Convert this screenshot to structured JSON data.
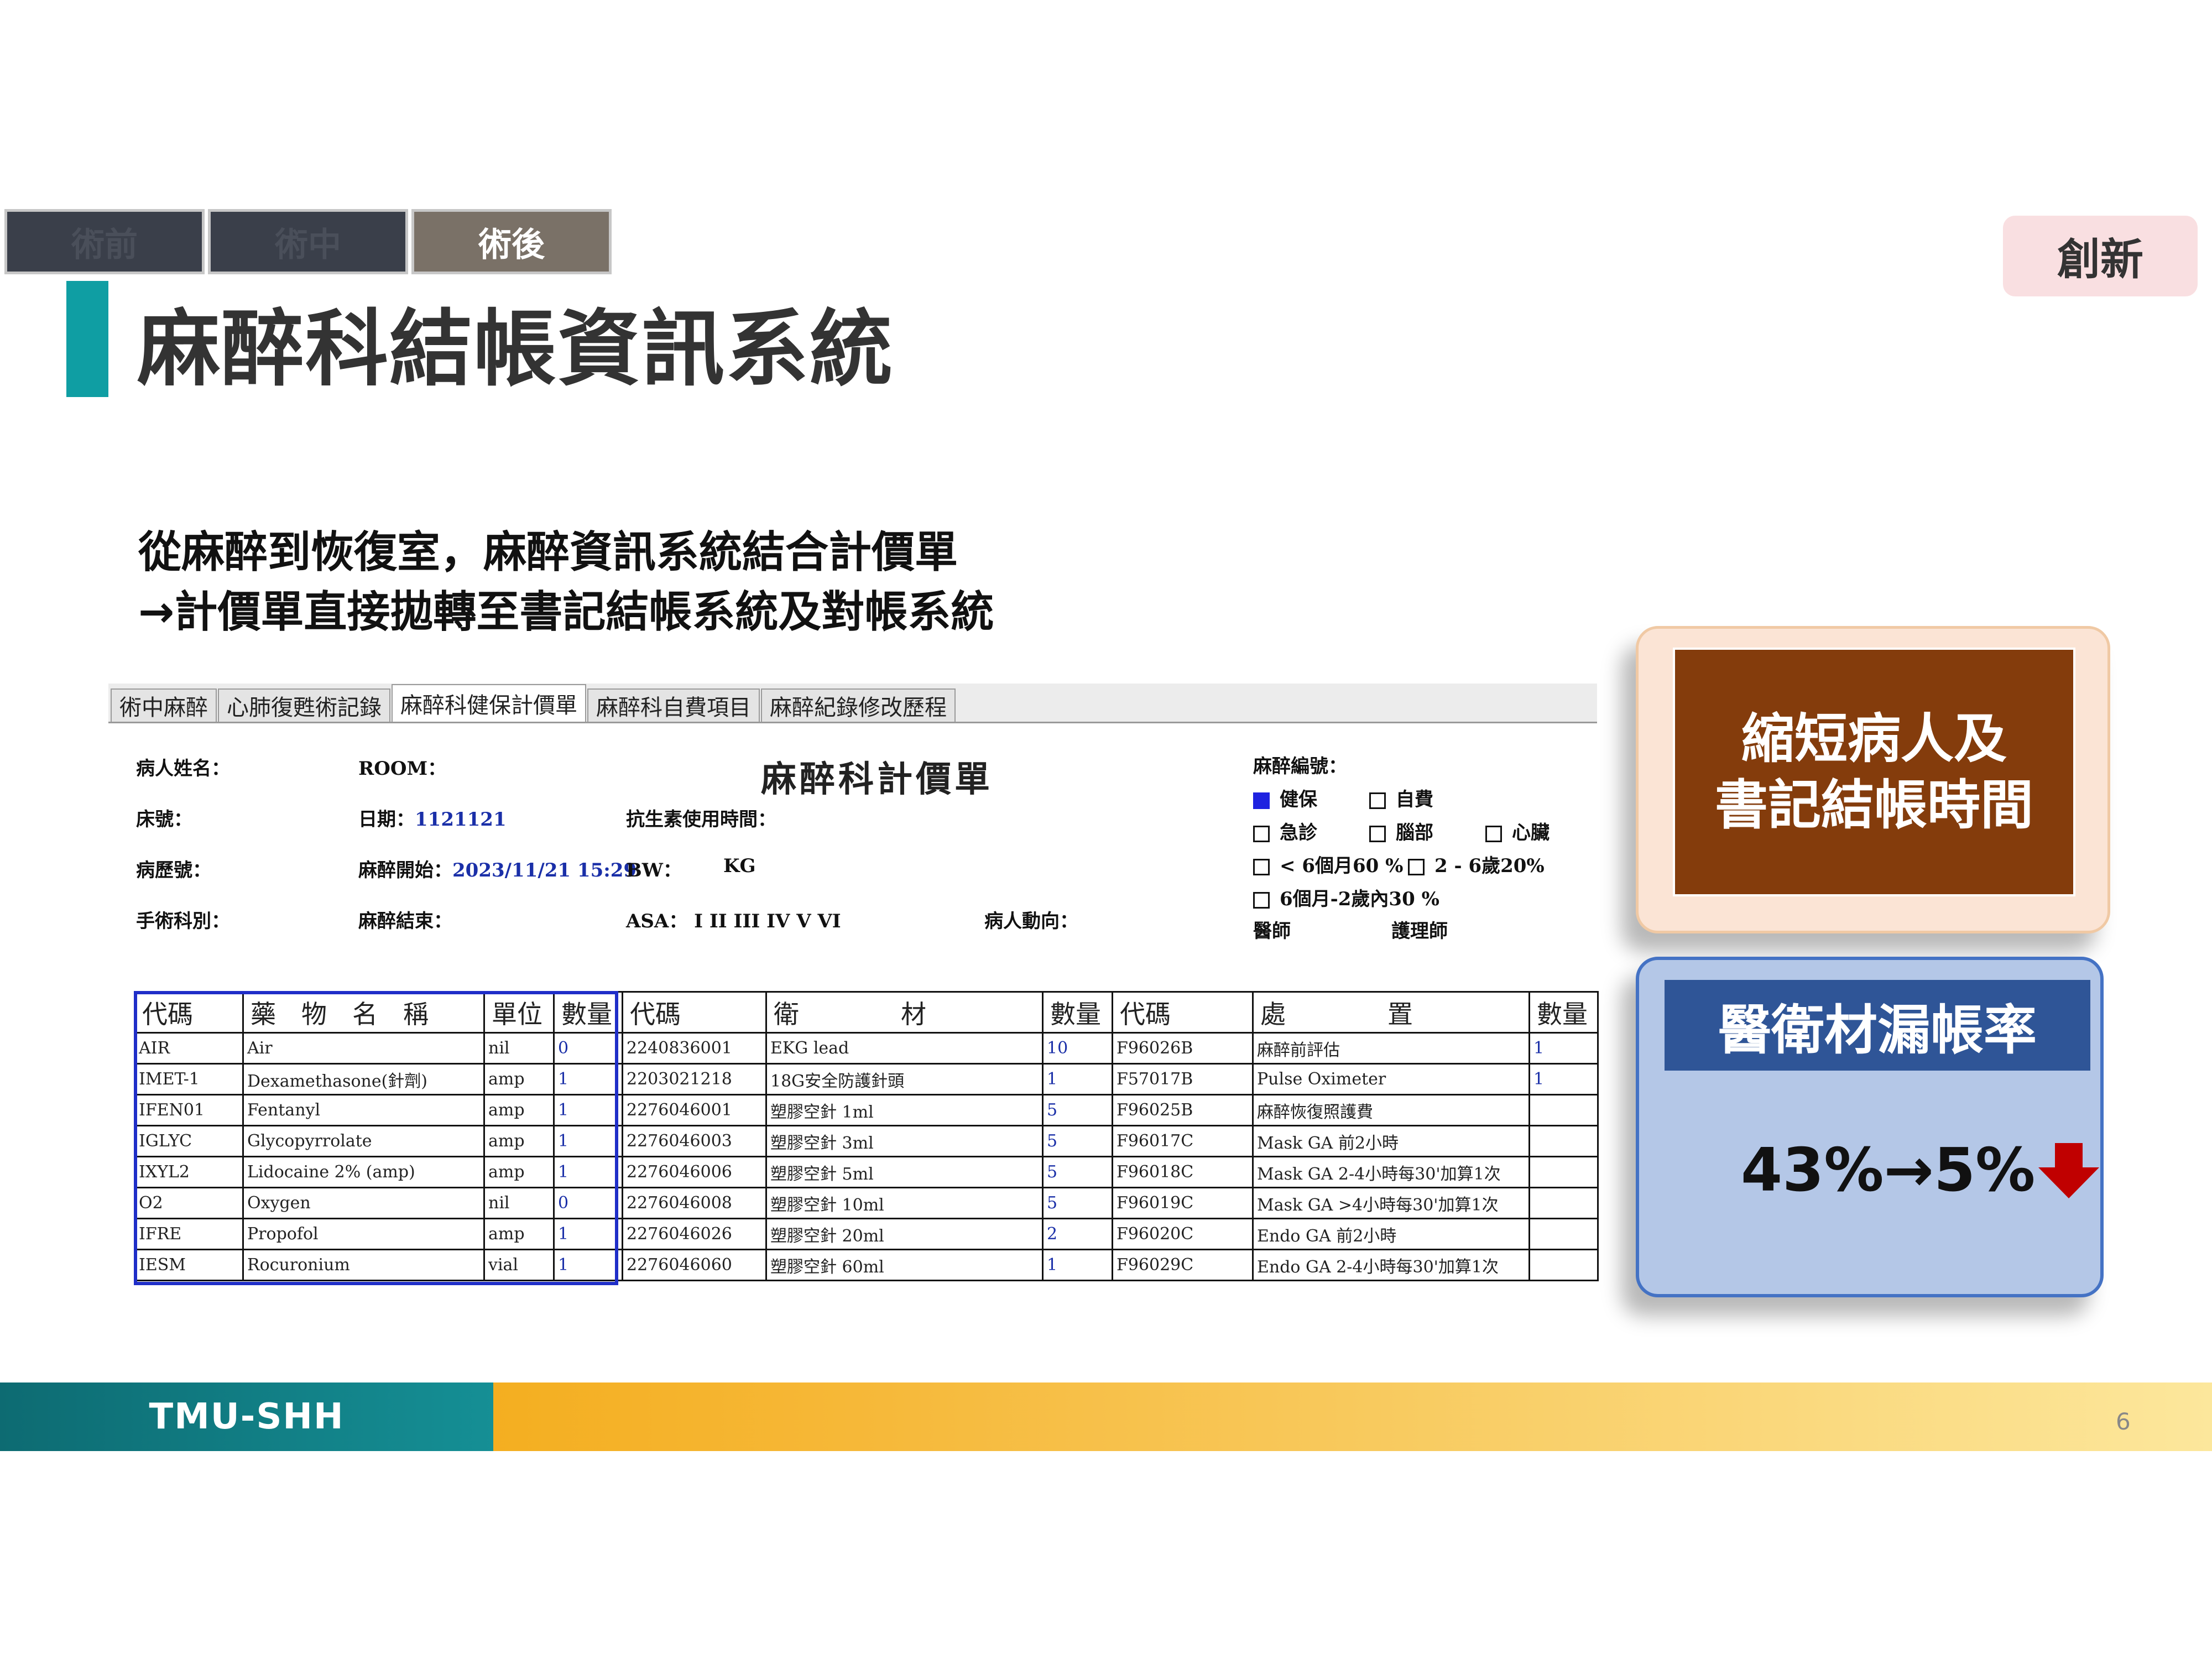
{
  "steps": [
    {
      "label": "術前"
    },
    {
      "label": "術中"
    },
    {
      "label": "術後"
    }
  ],
  "badge": "創新",
  "title": "麻醉科結帳資訊系統",
  "subtitle": {
    "line1": "從麻醉到恢復室，麻醉資訊系統結合計價單",
    "line2": "→計價單直接拋轉至書記結帳系統及對帳系統"
  },
  "form": {
    "tabs": [
      "術中麻醉",
      "心肺復甦術記錄",
      "麻醉科健保計價單",
      "麻醉科自費項目",
      "麻醉紀錄修改歷程"
    ],
    "title": "麻醉科計價單",
    "labels": {
      "patient_name": "病人姓名：",
      "room": "ROOM：",
      "bed": "床號：",
      "date": "日期：",
      "date_value": "1121121",
      "antibiotic": "抗生素使用時間：",
      "chart_no": "病歷號：",
      "anes_start": "麻醉開始：",
      "anes_start_value": "2023/11/21  15:29",
      "bw": "BW：",
      "kg": "KG",
      "surgery_dept": "手術科別：",
      "anes_end": "麻醉結束：",
      "asa": "ASA：  I     II     III    IV    V    VI",
      "patient_status": "病人動向：",
      "anes_no": "麻醉編號：",
      "nhi": "健保",
      "self_pay": "自費",
      "emergency": "急診",
      "brain": "腦部",
      "heart": "心臟",
      "under6m": "< 6個月60 %",
      "age2to6": "2 - 6歲20%",
      "age6mto2": "6個月-2歲內30 %",
      "doctor": "醫師",
      "nurse": "護理師"
    },
    "table": {
      "headers": [
        "代碼",
        "藥　物　名　稱",
        "單位",
        "數量",
        "代碼",
        "衛　　　　材",
        "數量",
        "代碼",
        "處　　　　置",
        "數量"
      ],
      "rows": [
        [
          "AIR",
          "Air",
          "nil",
          "0",
          "2240836001",
          "EKG lead",
          "10",
          "F96026B",
          "麻醉前評估",
          "1"
        ],
        [
          "IMET-1",
          "Dexamethasone(針劑)",
          "amp",
          "1",
          "2203021218",
          "18G安全防護針頭",
          "1",
          "F57017B",
          "Pulse Oximeter",
          "1"
        ],
        [
          "IFEN01",
          "Fentanyl",
          "amp",
          "1",
          "2276046001",
          "塑膠空針 1ml",
          "5",
          "F96025B",
          "麻醉恢復照護費",
          ""
        ],
        [
          "IGLYC",
          "Glycopyrrolate",
          "amp",
          "1",
          "2276046003",
          "塑膠空針 3ml",
          "5",
          "F96017C",
          "Mask GA 前2小時",
          ""
        ],
        [
          "IXYL2",
          "Lidocaine 2% (amp)",
          "amp",
          "1",
          "2276046006",
          "塑膠空針 5ml",
          "5",
          "F96018C",
          "Mask GA 2-4小時每30'加算1次",
          ""
        ],
        [
          "O2",
          "Oxygen",
          "nil",
          "0",
          "2276046008",
          "塑膠空針 10ml",
          "5",
          "F96019C",
          "Mask GA >4小時每30'加算1次",
          ""
        ],
        [
          "IFRE",
          "Propofol",
          "amp",
          "1",
          "2276046026",
          "塑膠空針 20ml",
          "2",
          "F96020C",
          "Endo GA 前2小時",
          ""
        ],
        [
          "IESM",
          "Rocuronium",
          "vial",
          "1",
          "2276046060",
          "塑膠空針 60ml",
          "1",
          "F96029C",
          "Endo GA 2-4小時每30'加算1次",
          ""
        ]
      ]
    }
  },
  "card1": {
    "line1": "縮短病人及",
    "line2": "書記結帳時間"
  },
  "card2": {
    "head": "醫衛材漏帳率",
    "stat": "43%→5%"
  },
  "footer": {
    "brand": "TMU-SHH",
    "page": "6"
  },
  "colors": {
    "teal": "#0f9ea3",
    "brown": "#843c0c",
    "navy": "#2f5597",
    "arrow": "#c00000"
  }
}
